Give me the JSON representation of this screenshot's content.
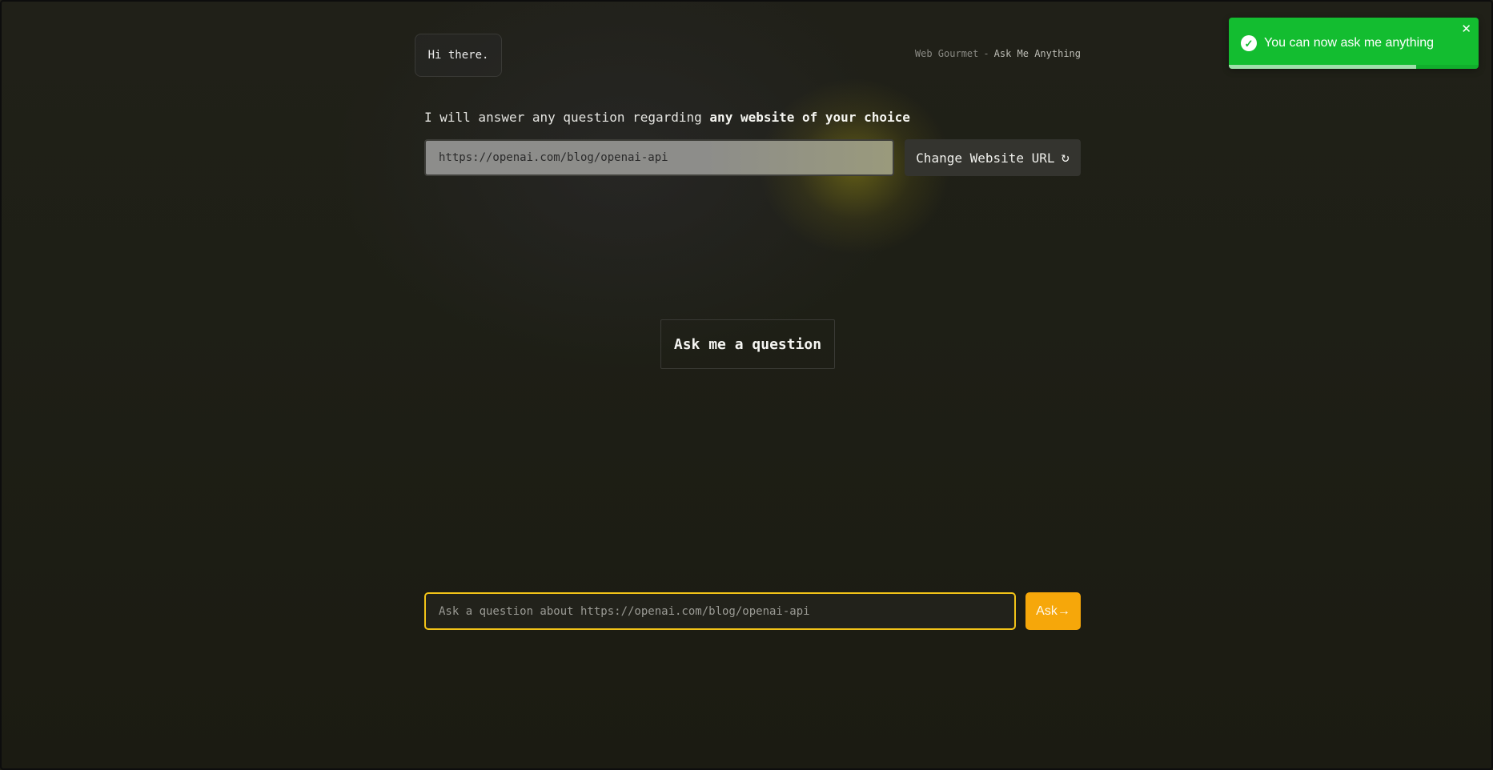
{
  "header": {
    "greeting": "Hi there.",
    "brand_name": "Web Gourmet",
    "brand_separator": "-",
    "brand_tagline": "Ask Me Anything"
  },
  "intro": {
    "text": "I will answer any question regarding",
    "emphasis": "any website of your choice"
  },
  "url_field": {
    "value": "https://openai.com/blog/openai-api"
  },
  "change_url_button": {
    "label": "Change Website URL",
    "icon": "refresh-icon",
    "glyph": "↻"
  },
  "main": {
    "heading": "Ask me a question"
  },
  "question_form": {
    "input_value": "",
    "placeholder": "Ask a question about https://openai.com/blog/openai-api",
    "ask_label": "Ask→"
  },
  "toast": {
    "message": "You can now ask me anything",
    "status": "success",
    "check_glyph": "✓",
    "close_glyph": "✕",
    "progress": 0.75
  },
  "colors": {
    "accent": "#f2c318",
    "ask_button": "#f6a70a",
    "toast_success": "#13bd30"
  }
}
